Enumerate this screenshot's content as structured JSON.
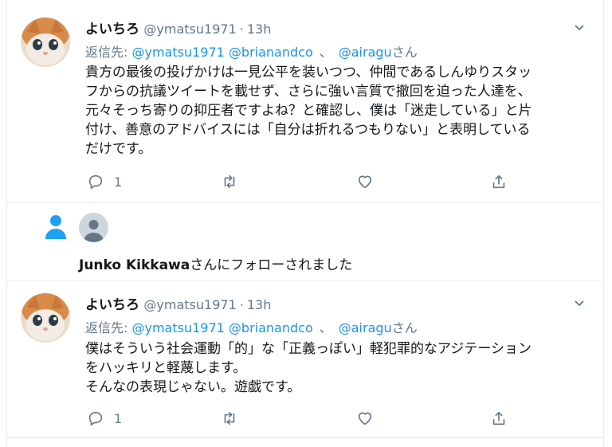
{
  "tweets": [
    {
      "name": "よいちろ",
      "handle": "@ymatsu1971",
      "time": "13h",
      "reply_prefix": "返信先:",
      "mentions": [
        "@ymatsu1971",
        "@brianandco",
        "@airagu"
      ],
      "mention_sep": "、",
      "reply_suffix": "さん",
      "text": "貴方の最後の投げかけは一見公平を装いつつ、仲間であるしんゆりスタッ\nフからの抗議ツイートを載せず、さらに強い言質で撤回を迫った人達を、\n元々そっち寄りの抑圧者ですよね？と確認し、僕は「迷走している」と片\n付け、善意のアドバイスには「自分は折れるつもりない」と表明している\nだけです。",
      "reply_count": "1"
    },
    {
      "name": "よいちろ",
      "handle": "@ymatsu1971",
      "time": "13h",
      "reply_prefix": "返信先:",
      "mentions": [
        "@ymatsu1971",
        "@brianandco",
        "@airagu"
      ],
      "mention_sep": "、",
      "reply_suffix": "さん",
      "text": "僕はそういう社会運動「的」な「正義っぽい」軽犯罪的なアジテーション\nをハッキリと軽蔑します。\nそんなの表現じゃない。遊戯です。",
      "reply_count": "1"
    }
  ],
  "notification": {
    "user": "Junko Kikkawa",
    "text": "さんにフォローされました"
  },
  "colors": {
    "link": "#1b95e0",
    "muted": "#657786",
    "border": "#e6ecf0",
    "follow_icon": "#1da1f2"
  },
  "icons": [
    "chevron-down-icon",
    "reply-icon",
    "retweet-icon",
    "like-icon",
    "share-icon",
    "person-icon",
    "default-avatar-icon"
  ]
}
